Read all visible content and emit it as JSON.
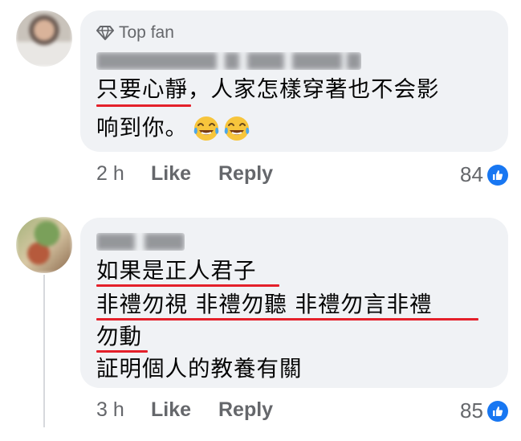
{
  "comments": [
    {
      "badge": "Top fan",
      "text_lines": [
        "只要心靜，人家怎樣穿著也不会影",
        "响到你。"
      ],
      "emojis": [
        "joy-emoji",
        "joy-emoji"
      ],
      "time": "2 h",
      "like_label": "Like",
      "reply_label": "Reply",
      "reaction_count": "84",
      "reaction_icon": "thumbs-up-icon"
    },
    {
      "text_lines": [
        "如果是正人君子",
        "非禮勿視 非禮勿聽 非禮勿言非禮",
        "勿動",
        "証明個人的教養有關"
      ],
      "time": "3 h",
      "like_label": "Like",
      "reply_label": "Reply",
      "reaction_count": "85",
      "reaction_icon": "thumbs-up-icon"
    }
  ],
  "colors": {
    "bubble": "#f0f2f5",
    "meta_text": "#65676b",
    "like_badge": "#1877f2",
    "underline": "#e4202a"
  }
}
